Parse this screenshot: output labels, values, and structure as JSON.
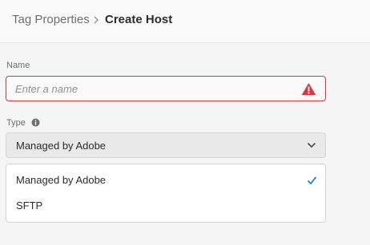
{
  "breadcrumb": {
    "parent": "Tag Properties",
    "separator": "›",
    "current": "Create Host"
  },
  "form": {
    "name": {
      "label": "Name",
      "value": "",
      "placeholder": "Enter a name",
      "state": "error",
      "icon": "alert-icon"
    },
    "type": {
      "label": "Type",
      "info_icon": "info-icon",
      "selected": "Managed by Adobe",
      "icon": "chevron-down-icon"
    }
  },
  "type_menu": {
    "items": [
      {
        "label": "Managed by Adobe",
        "selected": true
      },
      {
        "label": "SFTP",
        "selected": false
      }
    ]
  },
  "colors": {
    "error": "#d7373f",
    "accent": "#2680eb",
    "text": "#2c2c2c"
  }
}
